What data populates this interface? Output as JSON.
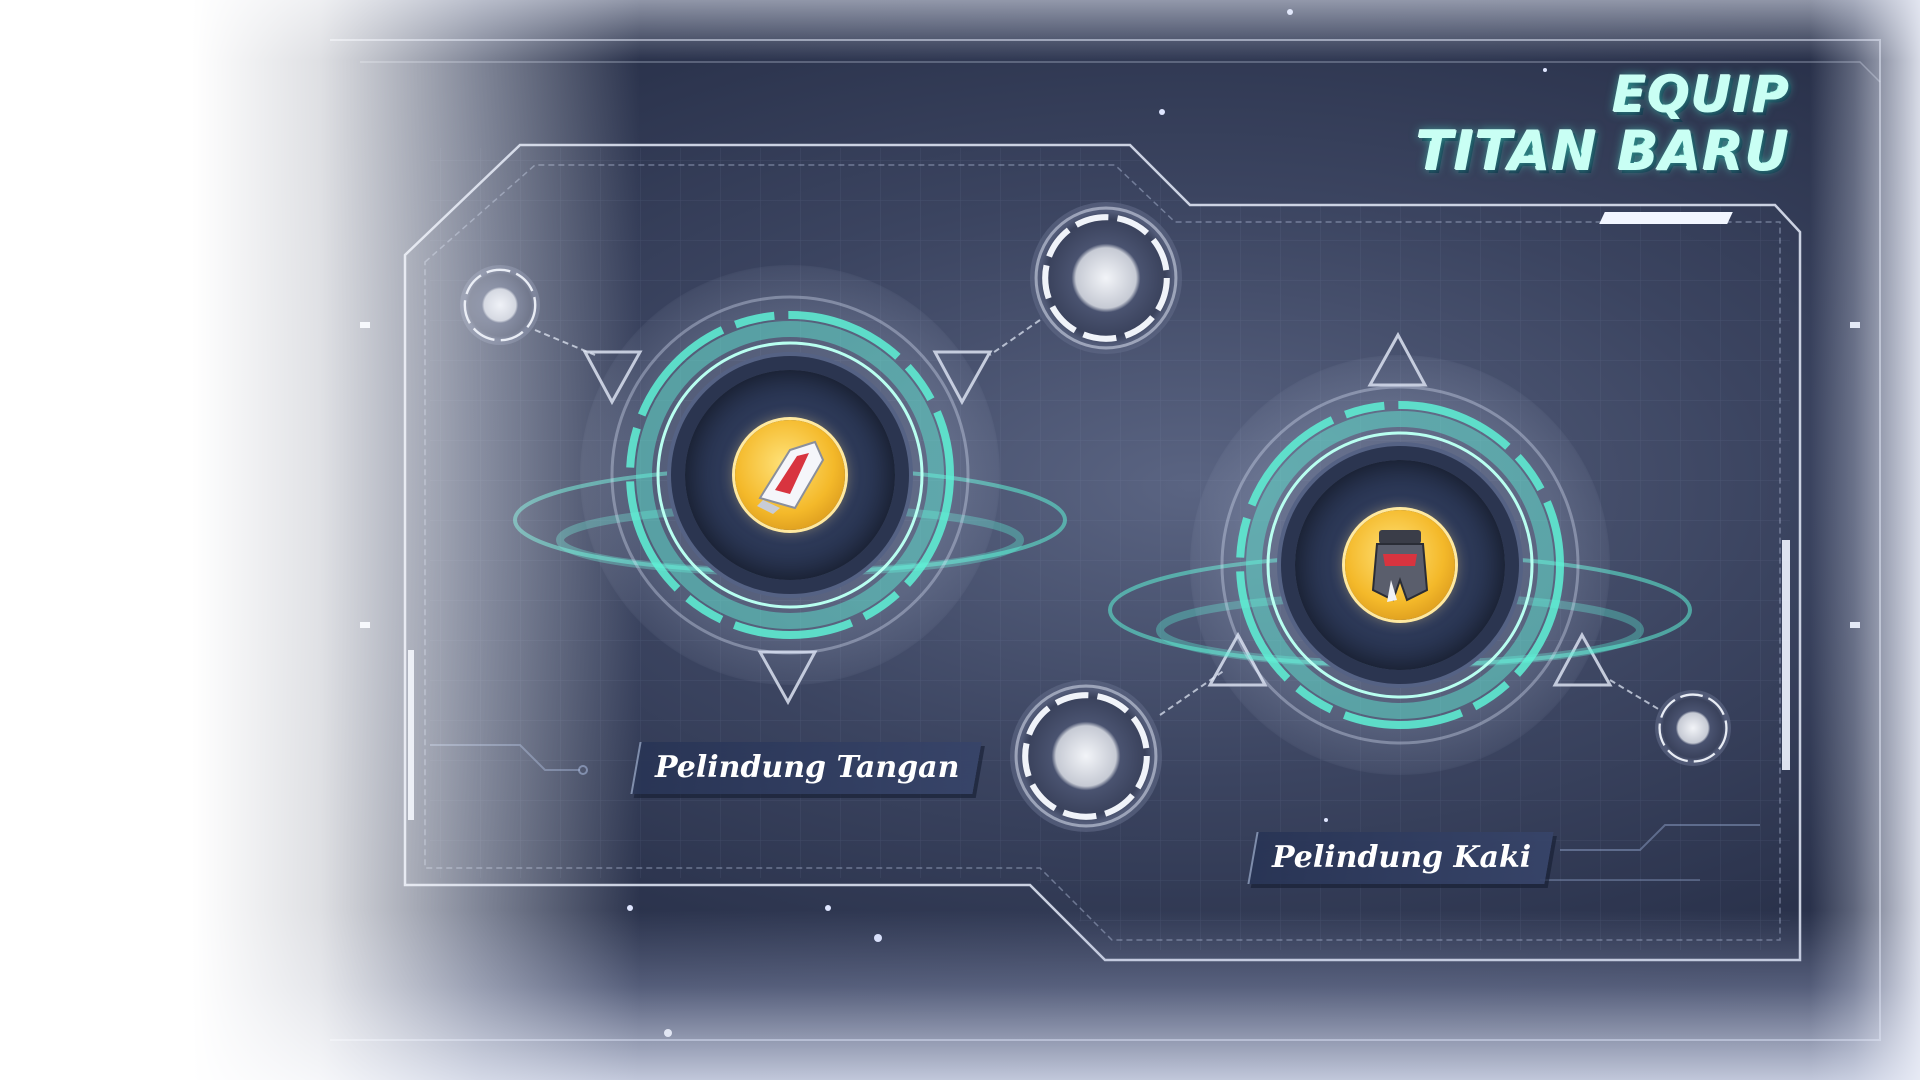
{
  "title": {
    "line1": "EQUIP",
    "line2": "TITAN BARU"
  },
  "slots": [
    {
      "label": "Pelindung Tangan",
      "icon": "hand-guard-icon"
    },
    {
      "label": "Pelindung Kaki",
      "icon": "leg-guard-icon"
    }
  ],
  "colors": {
    "accent": "#5ef2d6",
    "title": "#c9fff4",
    "panel": "#2b3755",
    "item_gold": "#f4b92a"
  }
}
